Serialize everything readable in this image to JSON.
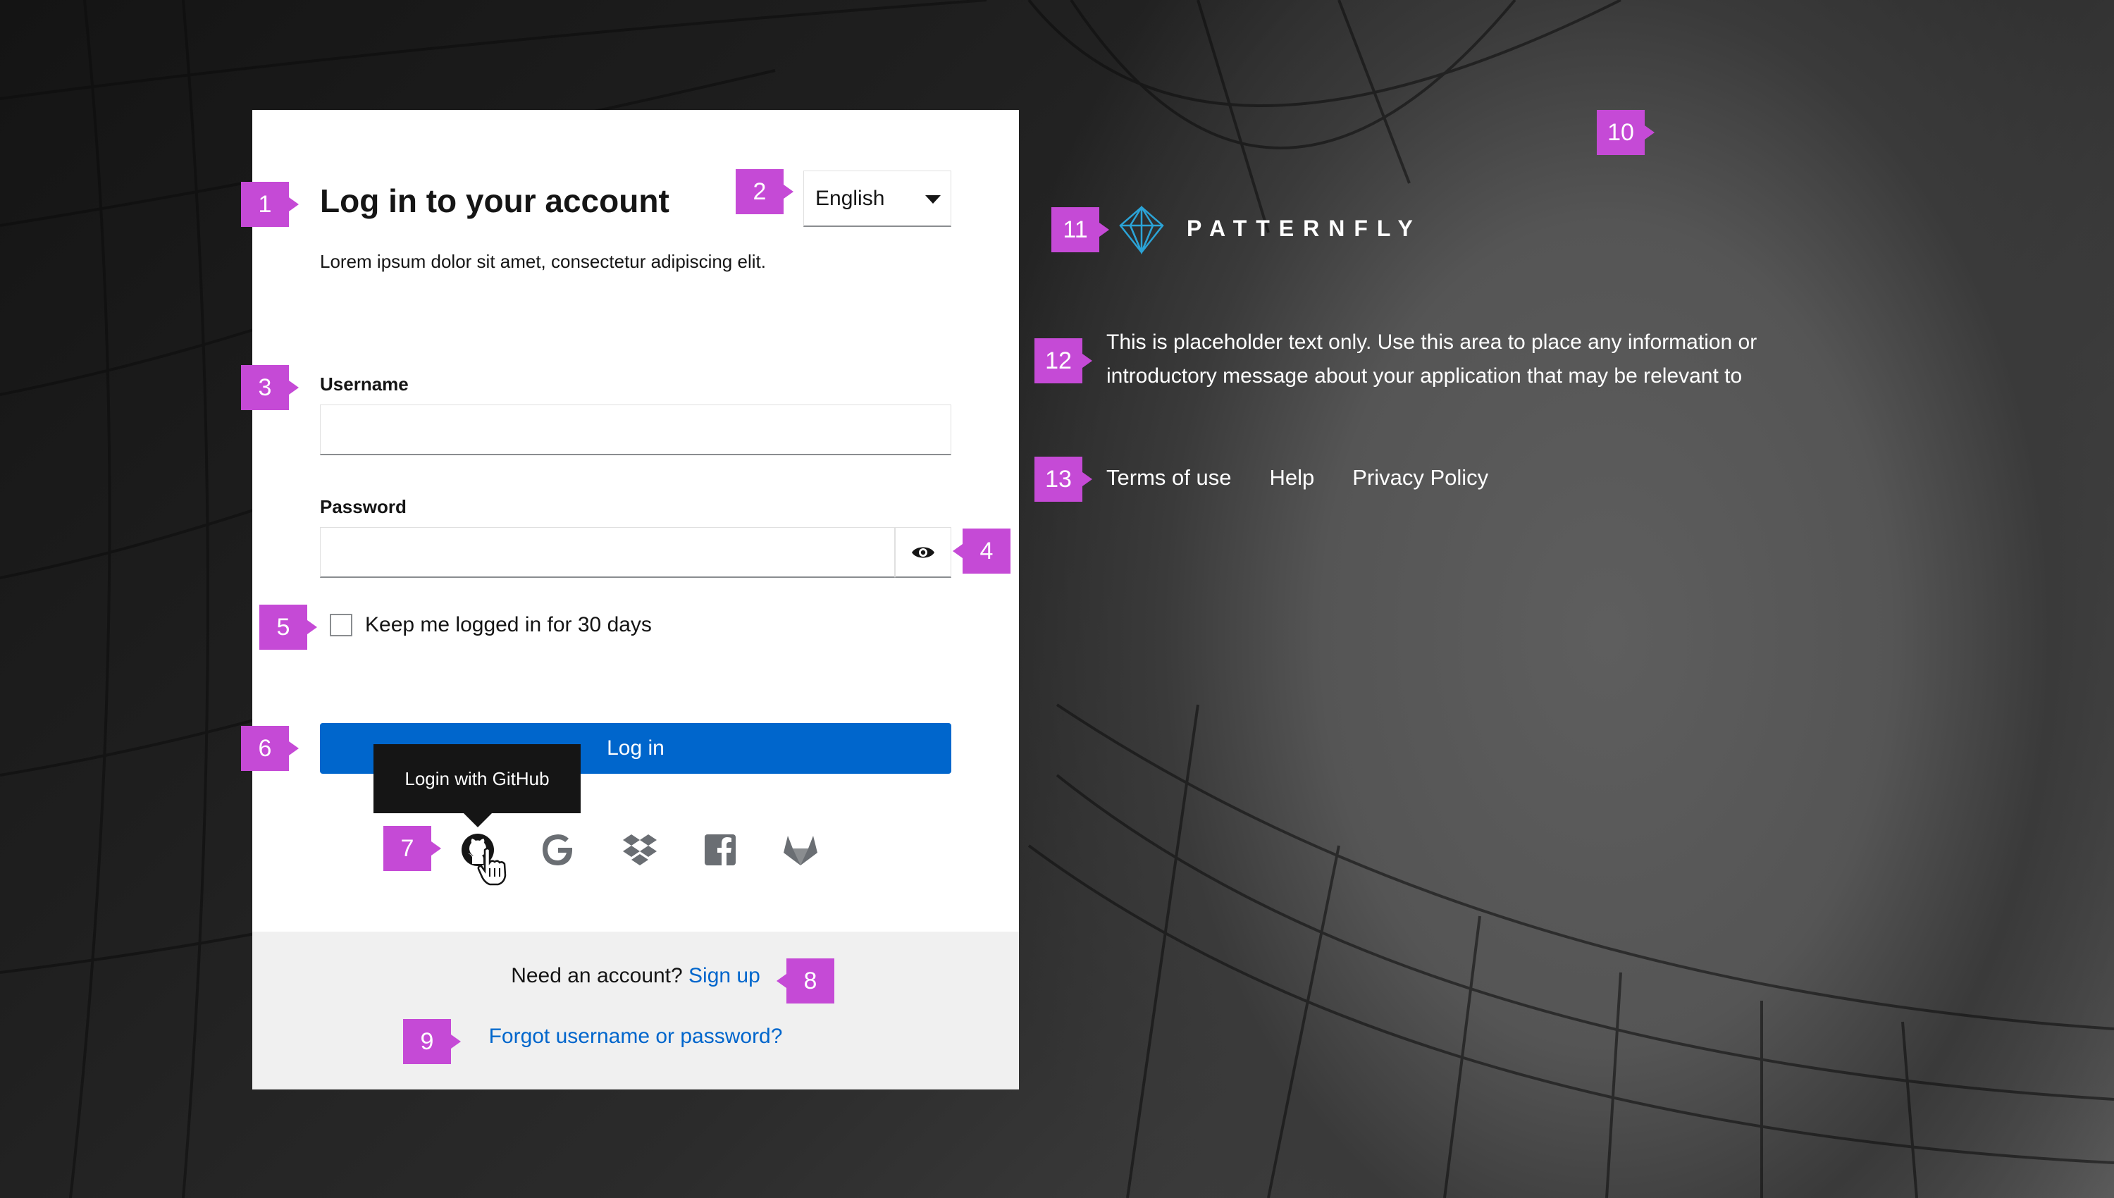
{
  "card": {
    "title": "Log in to your account",
    "subtitle": "Lorem ipsum dolor sit amet, consectetur adipiscing elit.",
    "language": "English",
    "username_label": "Username",
    "username_value": "",
    "password_label": "Password",
    "password_value": "",
    "remember_label": "Keep me logged in for 30 days",
    "remember_checked": false,
    "login_button": "Log in",
    "tooltip": "Login with GitHub",
    "social": [
      "github-icon",
      "google-icon",
      "dropbox-icon",
      "facebook-icon",
      "gitlab-icon"
    ],
    "footer_prompt": "Need an account?",
    "signup_link": "Sign up",
    "forgot_link": "Forgot username or password?"
  },
  "brand": {
    "name": "PATTERNFLY",
    "intro_line1": "This is placeholder text only. Use this area to place any information or",
    "intro_line2": "introductory message about your application that may be relevant to",
    "links": [
      "Terms of use",
      "Help",
      "Privacy Policy"
    ]
  },
  "markers": [
    "1",
    "2",
    "3",
    "4",
    "5",
    "6",
    "7",
    "8",
    "9",
    "10",
    "11",
    "12",
    "13"
  ],
  "colors": {
    "primary": "#0066cc",
    "marker": "#c54ad6",
    "logo": "#2ba3d6"
  }
}
